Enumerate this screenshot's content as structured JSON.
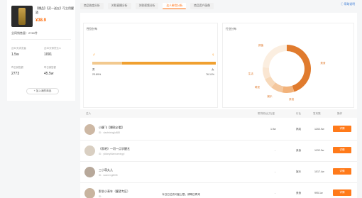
{
  "product": {
    "title": "【爆品】【买一送五】可立用醒酒",
    "price": "¥38.9",
    "total_sales_label": "全网销售量：2760件"
  },
  "stats": [
    {
      "label": "近30天浏览量",
      "value": "1.5w"
    },
    {
      "label": "近30天带货达人",
      "value": "1091"
    },
    {
      "label": "昨日销售额",
      "value": "2773"
    },
    {
      "label": "昨日销售额",
      "value": "45.5w"
    }
  ],
  "add_button": "+ 加入我的商品",
  "tabs": [
    "商品热度分析",
    "关联直播分析",
    "关联视频分析",
    "达人带货分析",
    "商品用户画像"
  ],
  "active_tab_index": 3,
  "help_link": "帮助说明",
  "gender": {
    "title": "性别分布",
    "male_label": "男",
    "male_pct": "23.89%",
    "female_label": "女",
    "female_pct": "76.11%",
    "male_fraction": 0.2389
  },
  "industry": {
    "title": "行业分布",
    "slices": [
      {
        "name": "美食",
        "color": "#e07b2e",
        "value": 45
      },
      {
        "name": "其他",
        "color": "#f2b27a",
        "value": 8
      },
      {
        "name": "娱乐",
        "color": "#f4c79d",
        "value": 8
      },
      {
        "name": "萌宠",
        "color": "#f7d9ba",
        "value": 7
      },
      {
        "name": "生活",
        "color": "#fae6d2",
        "value": 8
      },
      {
        "name": "颜值",
        "color": "#fbeee0",
        "value": 24
      }
    ],
    "labels_left": [
      "颜值",
      "生活",
      "萌宠",
      "娱乐",
      "其他"
    ],
    "labels_right": [
      "美食"
    ]
  },
  "table": {
    "headers": [
      "达人",
      "带货粉丝(万)量",
      "行业",
      "发布数",
      "操作"
    ],
    "rows": [
      {
        "name": "小醒飞【爆款必看】",
        "sub": "ID：xiaofeixingjiu888",
        "fans": "1.9w",
        "industry": "搞笑",
        "count": "1202.9w",
        "action": "详情"
      },
      {
        "name": "《家吧》一切一点学醒艺",
        "sub": "ID：yidianyidianxuexingyi",
        "fans": "-",
        "industry": "美食",
        "count": "1132.3w",
        "action": "详情"
      },
      {
        "name": "三小萌丸儿",
        "sub": "ID：sanmeng8008",
        "fans": "-",
        "industry": "娱乐",
        "count": "1017.4w",
        "action": "详情"
      },
      {
        "name": "那艺小青年（醒酒专区）",
        "sub": "ID：",
        "fans": "-",
        "industry": "美食",
        "count": "995.1w",
        "action": "详情"
      }
    ]
  },
  "footer": "今日已达访问量上限，请明日再来"
}
